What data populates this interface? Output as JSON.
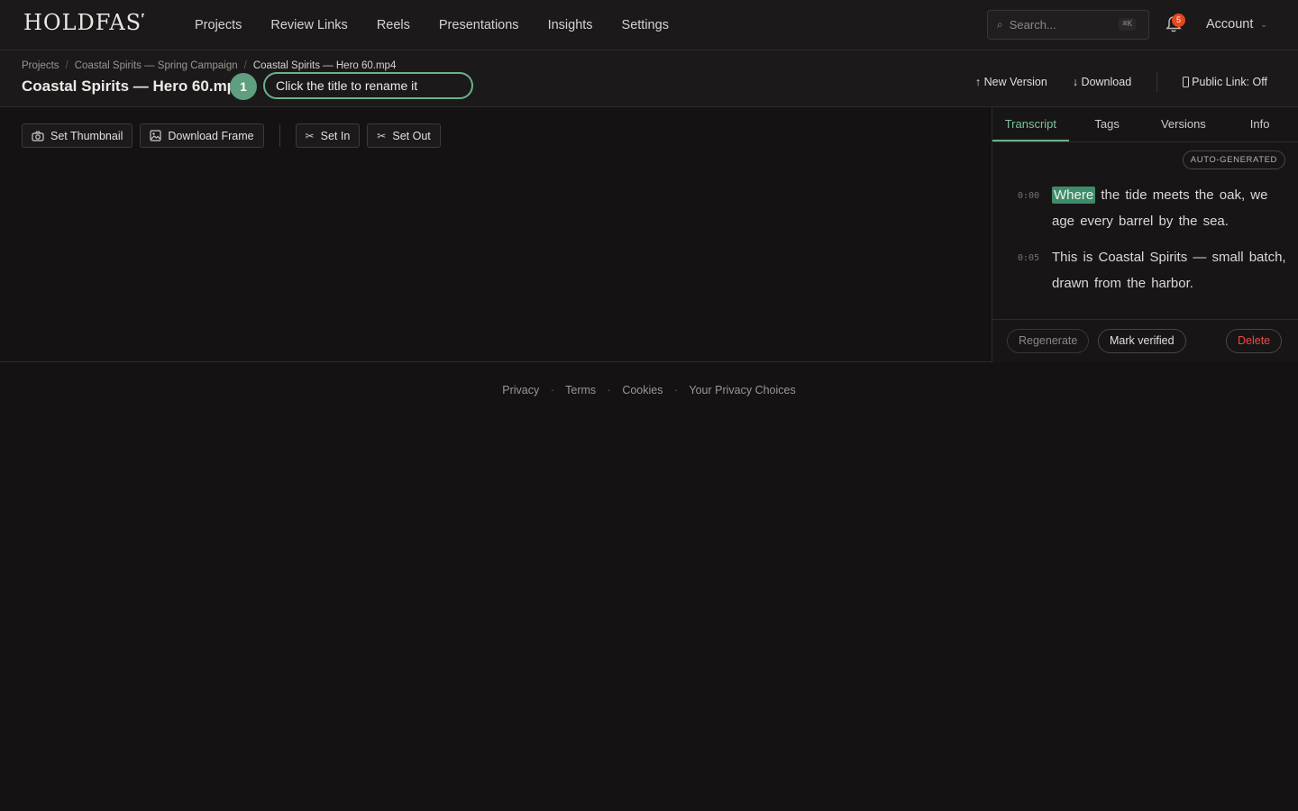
{
  "brand": {
    "logo_text": "HOLDFAST"
  },
  "nav": {
    "items": [
      "Projects",
      "Review Links",
      "Reels",
      "Presentations",
      "Insights",
      "Settings"
    ]
  },
  "search": {
    "placeholder": "Search...",
    "shortcut": "⌘K",
    "icon": "search-icon"
  },
  "notifications": {
    "count": "5",
    "icon": "bell-icon"
  },
  "account": {
    "label": "Account",
    "icon": "chevron-down-icon"
  },
  "breadcrumb": [
    "Projects",
    "Coastal Spirits — Spring Campaign",
    "Coastal Spirits — Hero 60.mp4"
  ],
  "asset": {
    "title": "Coastal Spirits — Hero 60.mp4"
  },
  "onboarding": {
    "step": "1",
    "hint": "Click the title to rename it"
  },
  "header_actions": {
    "new_version": "↑ New Version",
    "download": "↓ Download",
    "public_link": "Public Link: Off"
  },
  "toolbar": {
    "set_thumbnail": "Set Thumbnail",
    "download_frame": "Download Frame",
    "set_in": "Set In",
    "set_out": "Set Out"
  },
  "panel": {
    "tabs": [
      "Transcript",
      "Tags",
      "Versions",
      "Info"
    ],
    "active_tab": "Transcript",
    "badge": "AUTO-GENERATED",
    "transcript": [
      {
        "time": "0:00",
        "highlight": "Where",
        "text": " the tide meets the oak, we age every barrel by the sea."
      },
      {
        "time": "0:05",
        "highlight": "",
        "text": "This is Coastal Spirits — small batch, drawn from the harbor."
      }
    ],
    "actions": {
      "regenerate": "Regenerate",
      "mark_verified": "Mark verified",
      "delete": "Delete"
    }
  },
  "footer": {
    "links": [
      "Privacy",
      "Terms",
      "Cookies",
      "Your Privacy Choices"
    ]
  },
  "colors": {
    "accent": "#6bb18c",
    "danger": "#ef4a44",
    "badge": "#e8461c",
    "background": "#141213"
  }
}
